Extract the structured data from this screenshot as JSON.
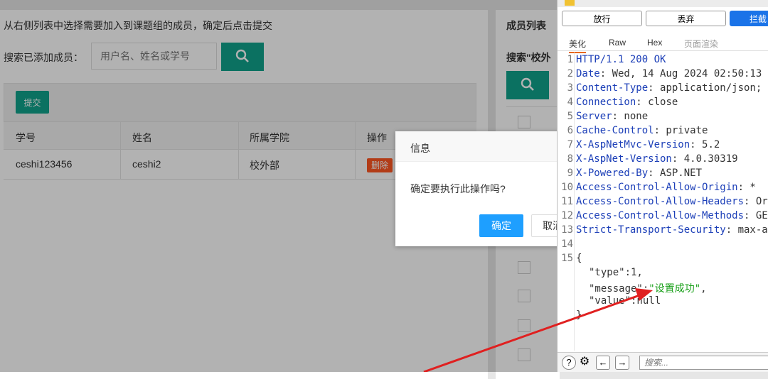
{
  "left": {
    "title": "从右侧列表中选择需要加入到课题组的成员，确定后点击提交",
    "search_label": "搜索已添加成员：",
    "search_placeholder": "用户名、姓名或学号",
    "submit_label": "提交",
    "columns": [
      "学号",
      "姓名",
      "所属学院",
      "操作"
    ],
    "rows": [
      {
        "id": "ceshi123456",
        "name": "ceshi2",
        "college": "校外部",
        "action": "删除"
      }
    ]
  },
  "right": {
    "title": "成员列表",
    "search_label": "搜索\"校外"
  },
  "dialog": {
    "title": "信息",
    "message": "确定要执行此操作吗?",
    "ok": "确定",
    "cancel": "取消"
  },
  "burp": {
    "buttons": [
      "放行",
      "丢弃",
      "拦截"
    ],
    "tabs": [
      "美化",
      "Raw",
      "Hex",
      "页面渲染"
    ],
    "lines": [
      {
        "n": "1",
        "key": "HTTP/1.1 200 OK",
        "val": ""
      },
      {
        "n": "2",
        "key": "Date",
        "val": ": Wed, 14 Aug 2024 02:50:13"
      },
      {
        "n": "3",
        "key": "Content-Type",
        "val": ": application/json;"
      },
      {
        "n": "4",
        "key": "Connection",
        "val": ": close"
      },
      {
        "n": "5",
        "key": "Server",
        "val": ": none"
      },
      {
        "n": "6",
        "key": "Cache-Control",
        "val": ": private"
      },
      {
        "n": "7",
        "key": "X-AspNetMvc-Version",
        "val": ": 5.2"
      },
      {
        "n": "8",
        "key": "X-AspNet-Version",
        "val": ": 4.0.30319"
      },
      {
        "n": "9",
        "key": "X-Powered-By",
        "val": ": ASP.NET"
      },
      {
        "n": "10",
        "key": "Access-Control-Allow-Origin",
        "val": ": *"
      },
      {
        "n": "11",
        "key": "Access-Control-Allow-Headers",
        "val": ": Or"
      },
      {
        "n": "12",
        "key": "Access-Control-Allow-Methods",
        "val": ": GE"
      },
      {
        "n": "13",
        "key": "Strict-Transport-Security",
        "val": ": max-a"
      },
      {
        "n": "14",
        "key": "",
        "val": ""
      },
      {
        "n": "15",
        "key": "{",
        "val": ""
      }
    ],
    "json_lines": [
      "\"type\":1,",
      "\"message\":",
      "\"设置成功\"",
      ",",
      "\"value\":null",
      "}"
    ],
    "search_placeholder": "搜索..."
  },
  "colors": {
    "accent_green": "#11a38b",
    "ok_blue": "#1e9fff",
    "delete_orange": "#ff5722",
    "arrow_red": "#e02020"
  }
}
